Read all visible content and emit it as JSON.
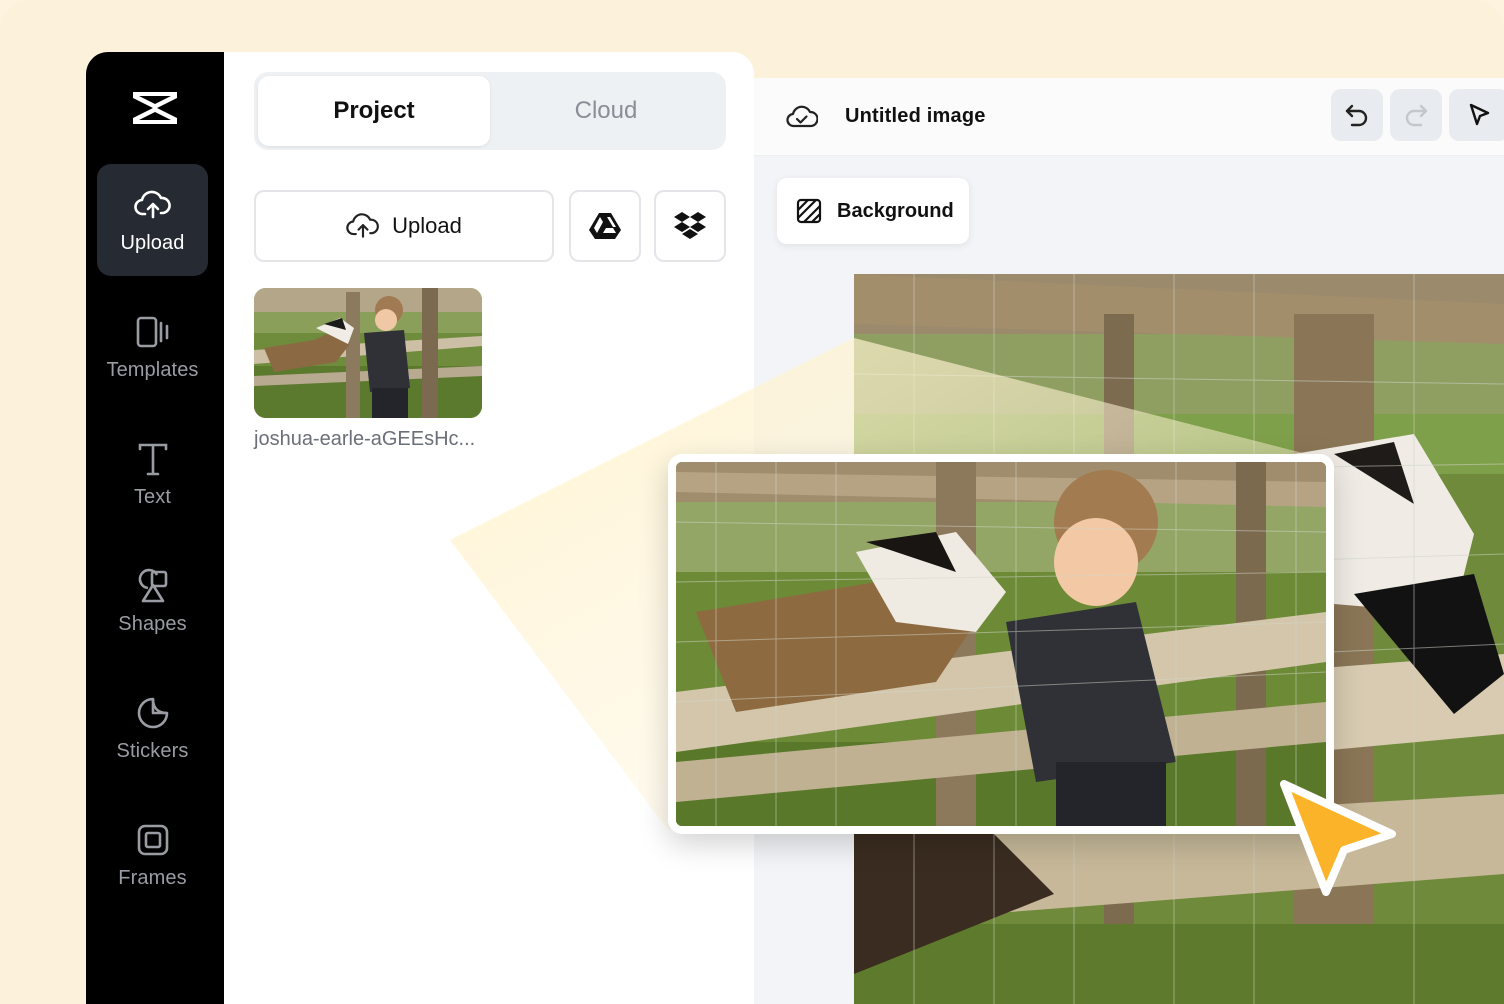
{
  "sidebar": {
    "items": [
      {
        "label": "Upload",
        "icon": "cloud-upload-icon",
        "active": true
      },
      {
        "label": "Templates",
        "icon": "templates-icon",
        "active": false
      },
      {
        "label": "Text",
        "icon": "text-icon",
        "active": false
      },
      {
        "label": "Shapes",
        "icon": "shapes-icon",
        "active": false
      },
      {
        "label": "Stickers",
        "icon": "sticker-icon",
        "active": false
      },
      {
        "label": "Frames",
        "icon": "frame-icon",
        "active": false
      }
    ]
  },
  "panel": {
    "tabs": [
      {
        "label": "Project",
        "active": true
      },
      {
        "label": "Cloud",
        "active": false
      }
    ],
    "upload_label": "Upload",
    "thumbnail_name": "joshua-earle-aGEEsHc..."
  },
  "editor": {
    "title": "Untitled image",
    "background_label": "Background"
  },
  "colors": {
    "accent_cursor": "#FBB42A",
    "sidebar_bg": "#000000",
    "active_nav": "#252A33"
  }
}
